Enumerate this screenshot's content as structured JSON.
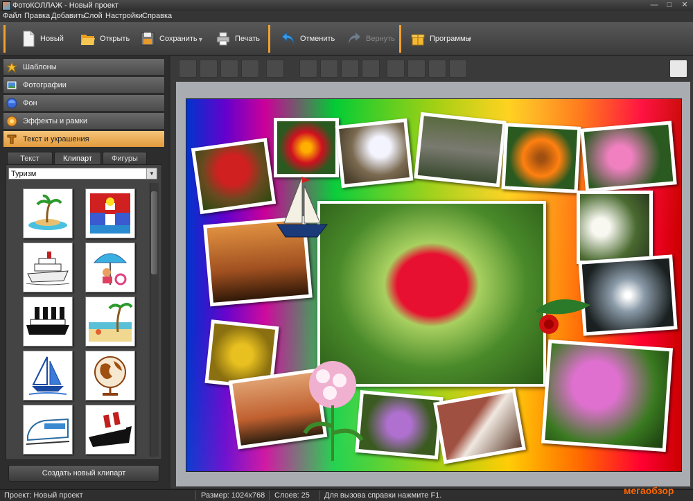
{
  "window": {
    "title": "ФотоКОЛЛАЖ - Новый проект"
  },
  "menu": [
    "Файл",
    "Правка",
    "Добавить",
    "Слой",
    "Настройки",
    "Справка"
  ],
  "toolbar": {
    "new": "Новый",
    "open": "Открыть",
    "save": "Сохранить",
    "print": "Печать",
    "undo": "Отменить",
    "redo": "Вернуть",
    "programs": "Программы"
  },
  "sidebar": {
    "sections": [
      {
        "label": "Шаблоны",
        "icon": "star-icon"
      },
      {
        "label": "Фотографии",
        "icon": "photos-icon"
      },
      {
        "label": "Фон",
        "icon": "background-icon"
      },
      {
        "label": "Эффекты и рамки",
        "icon": "effects-icon"
      },
      {
        "label": "Текст и украшения",
        "icon": "text-decor-icon",
        "active": true
      }
    ],
    "tabs": [
      "Текст",
      "Клипарт",
      "Фигуры"
    ],
    "active_tab": "Клипарт",
    "category": "Туризм",
    "clipart": [
      "island-clip",
      "lighthouse-clip",
      "cruise-ship-clip",
      "beach-umbrella-clip",
      "steamship-clip",
      "beach-palms-clip",
      "sailboat-clip",
      "globe-clip",
      "train-clip",
      "ocean-liner-clip"
    ],
    "create_button": "Создать новый клипарт"
  },
  "status": {
    "project": "Проект: Новый проект",
    "size": "Размер: 1024x768",
    "layers": "Слоев: 25",
    "hint": "Для вызова справки нажмите F1."
  },
  "watermark": "мегаобзор",
  "colors": {
    "accent": "#f0a030",
    "active_section": "#e39a3c"
  }
}
